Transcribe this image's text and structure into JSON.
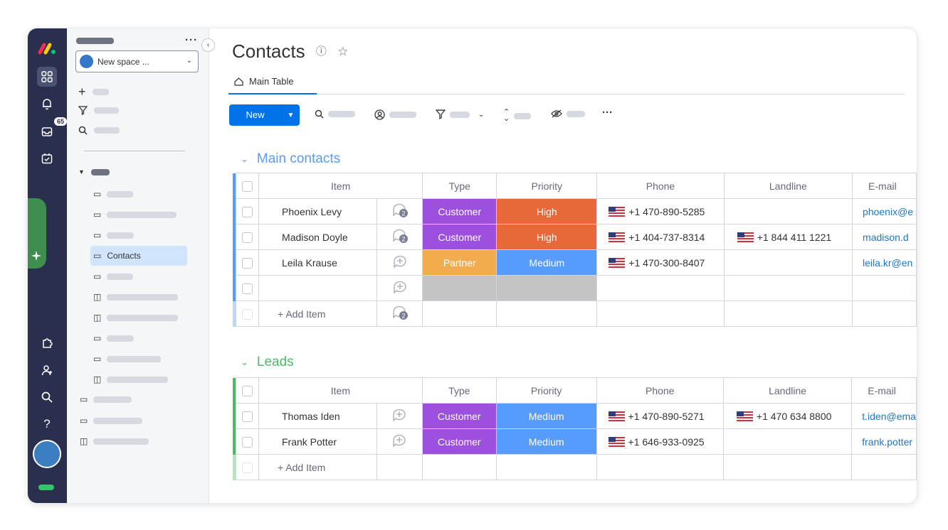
{
  "workspace": {
    "name": "New space ..."
  },
  "rail": {
    "inbox_badge": "65"
  },
  "sidebar": {
    "selected_item": "Contacts"
  },
  "board": {
    "title": "Contacts",
    "tab": "Main Table",
    "new_label": "New"
  },
  "columns": {
    "item": "Item",
    "type": "Type",
    "priority": "Priority",
    "phone": "Phone",
    "landline": "Landline",
    "email": "E-mail"
  },
  "groups": [
    {
      "title": "Main contacts",
      "color": "#579bfc",
      "add_label": "+ Add Item",
      "rows": [
        {
          "name": "Phoenix Levy",
          "updates": "2",
          "type": "Customer",
          "type_color": "#9d50dd",
          "priority": "High",
          "priority_color": "#e8683a",
          "phone": "+1 470-890-5285",
          "landline": "",
          "email": "phoenix@e"
        },
        {
          "name": "Madison Doyle",
          "updates": "2",
          "type": "Customer",
          "type_color": "#9d50dd",
          "priority": "High",
          "priority_color": "#e8683a",
          "phone": "+1 404-737-8314",
          "landline": "+1 844 411 1221",
          "email": "madison.d"
        },
        {
          "name": "Leila Krause",
          "updates": "",
          "type": "Partner",
          "type_color": "#f2ac4e",
          "priority": "Medium",
          "priority_color": "#579bfc",
          "phone": "+1 470-300-8407",
          "landline": "",
          "email": "leila.kr@en"
        },
        {
          "name": "",
          "updates": "",
          "type": "",
          "type_color": "#c4c4c4",
          "priority": "",
          "priority_color": "#c4c4c4",
          "phone": "",
          "landline": "",
          "email": ""
        }
      ],
      "add_updates": "2"
    },
    {
      "title": "Leads",
      "color": "#4fb96a",
      "add_label": "+ Add Item",
      "rows": [
        {
          "name": "Thomas Iden",
          "updates": "",
          "type": "Customer",
          "type_color": "#9d50dd",
          "priority": "Medium",
          "priority_color": "#579bfc",
          "phone": "+1 470-890-5271",
          "landline": "+1 470 634 8800",
          "email": "t.iden@ema"
        },
        {
          "name": "Frank Potter",
          "updates": "",
          "type": "Customer",
          "type_color": "#9d50dd",
          "priority": "Medium",
          "priority_color": "#579bfc",
          "phone": "+1 646-933-0925",
          "landline": "",
          "email": "frank.potter"
        }
      ]
    }
  ]
}
